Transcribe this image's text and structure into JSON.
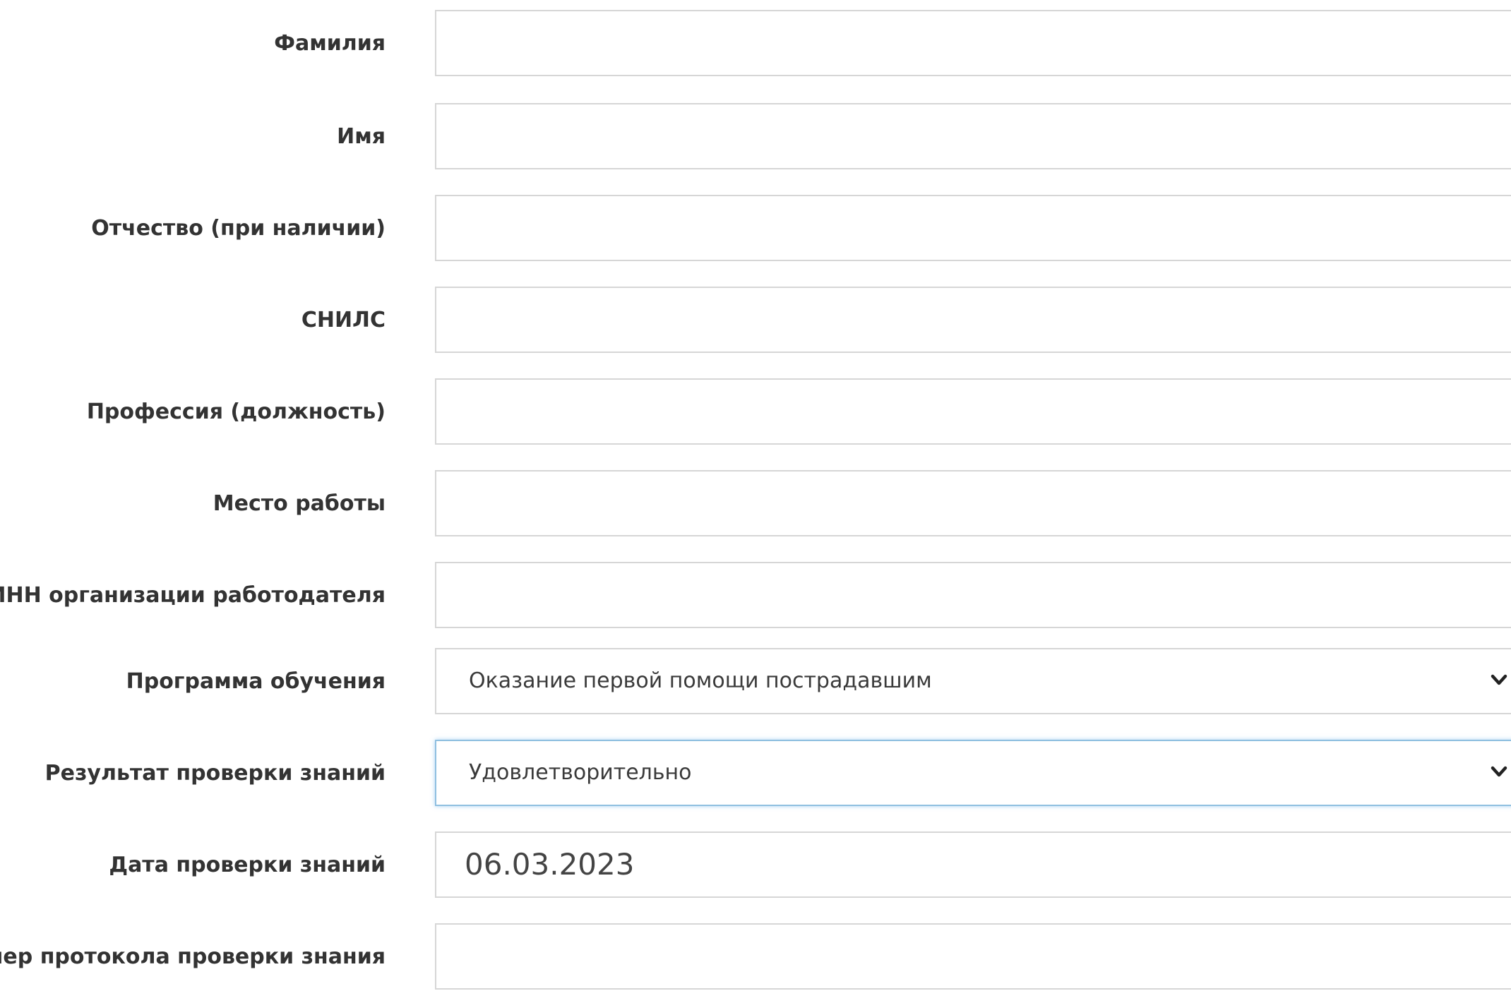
{
  "form": {
    "fields": [
      {
        "label": "Фамилия",
        "value": ""
      },
      {
        "label": "Имя",
        "value": ""
      },
      {
        "label": "Отчество (при наличии)",
        "value": ""
      },
      {
        "label": "СНИЛС",
        "value": ""
      },
      {
        "label": "Профессия (должность)",
        "value": ""
      },
      {
        "label": "Место работы",
        "value": ""
      },
      {
        "label": "ИНН организации работодателя",
        "value": ""
      },
      {
        "label": "Программа обучения",
        "value": "Оказание первой помощи пострадавшим"
      },
      {
        "label": "Результат проверки знаний",
        "value": "Удовлетворительно"
      },
      {
        "label": "Дата проверки знаний",
        "value": "06.03.2023"
      },
      {
        "label": "Номер протокола проверки знания",
        "value": ""
      }
    ]
  },
  "icons": {
    "dropdown": "chevron-down-icon"
  },
  "colors": {
    "focus_border": "#8fbfe0",
    "field_border": "#d6d6d6",
    "label_text": "#333333"
  }
}
